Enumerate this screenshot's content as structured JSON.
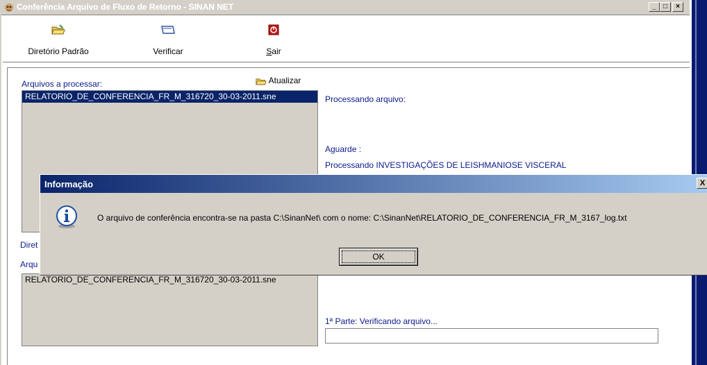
{
  "window": {
    "title": "Conferência Arquivo de Fluxo de Retorno - SINAN NET",
    "controls": {
      "minimize": "_",
      "maximize": "□",
      "close": "×"
    }
  },
  "toolbar": {
    "diretorio_label": "Diretório Padrão",
    "verificar_label": "Verificar",
    "sair_label": "Sair",
    "sair_mnemonic": "S"
  },
  "left_panel": {
    "arquivos_label": "Arquivos a processar:",
    "atualizar_label": "Atualizar",
    "files": [
      "RELATORIO_DE_CONFERENCIA_FR_M_316720_30-03-2011.sne"
    ],
    "diretorio_label_partial": "Diret",
    "arquivos2_label_partial": "Arqu",
    "files2": [
      "RELATORIO_DE_CONFERENCIA_FR_M_316720_30-03-2011.sne"
    ]
  },
  "right_panel": {
    "processando_label": "Processando arquivo:",
    "aguarde_label": "Aguarde :",
    "processando_item": "Processando INVESTIGAÇÕES DE LEISHMANIOSE VISCERAL",
    "parte_label": "1ª Parte: Verificando arquivo..."
  },
  "dialog": {
    "title": "Informação",
    "message": "O arquivo de conferência encontra-se na pasta C:\\SinanNet\\ com o nome: C:\\SinanNet\\RELATORIO_DE_CONFERENCIA_FR_M_3167_log.txt",
    "ok_label": "OK",
    "close_glyph": "X"
  },
  "colors": {
    "label_blue": "#0a1a8c",
    "selection": "#0a246a",
    "window_face": "#d4d0c8",
    "dialog_title_start": "#0a246a",
    "dialog_title_end": "#a6caf0"
  },
  "icons": {
    "app": "app-icon",
    "diretorio": "folder-open-icon",
    "verificar": "folder-icon",
    "sair": "power-icon",
    "atualizar": "folder-open-icon",
    "dialog": "info-icon"
  }
}
